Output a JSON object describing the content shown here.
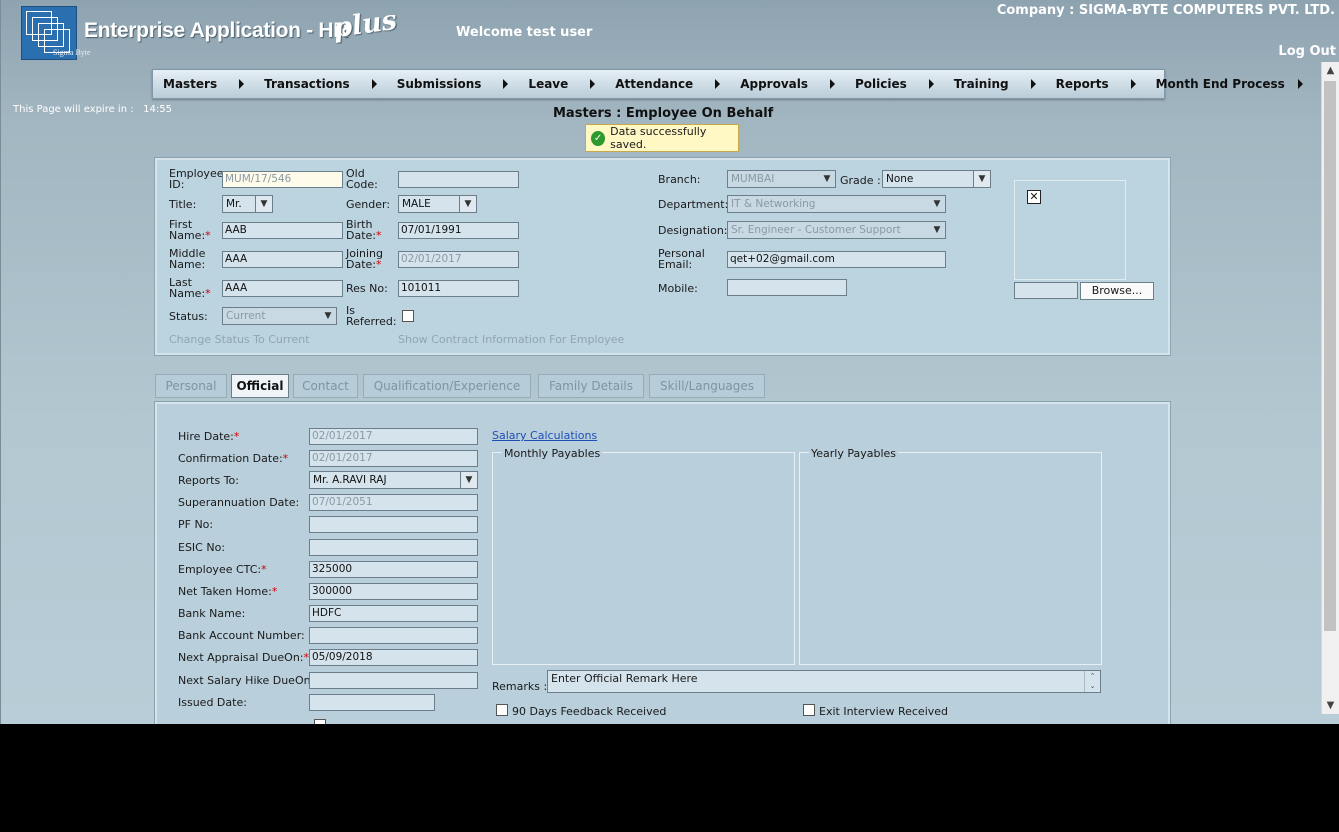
{
  "header": {
    "logo_small": "Sigma Byte",
    "app_title": "Enterprise Application - HR",
    "app_plus": "plus",
    "welcome": "Welcome test user",
    "company": "Company : SIGMA-BYTE COMPUTERS PVT. LTD.",
    "logout": "Log Out"
  },
  "nav": {
    "items": [
      {
        "label": "Masters"
      },
      {
        "label": "Transactions"
      },
      {
        "label": "Submissions"
      },
      {
        "label": "Leave"
      },
      {
        "label": "Attendance"
      },
      {
        "label": "Approvals"
      },
      {
        "label": "Policies"
      },
      {
        "label": "Training"
      },
      {
        "label": "Reports"
      },
      {
        "label": "Month End Process"
      }
    ]
  },
  "expire": "This Page will expire in :   14:55",
  "page_title": "Masters : Employee On Behalf",
  "saved_message": "Data successfully saved.",
  "employee": {
    "employee_id_label": "Employee ID:",
    "employee_id": "MUM/17/546",
    "old_code_label": "Old Code:",
    "old_code": "",
    "title_label": "Title:",
    "title": "Mr.",
    "gender_label": "Gender:",
    "gender": "MALE",
    "first_name_label": "First Name:",
    "first_name": "AAB",
    "birth_date_label": "Birth Date:",
    "birth_date": "07/01/1991",
    "middle_name_label": "Middle Name:",
    "middle_name": "AAA",
    "joining_date_label": "Joining Date:",
    "joining_date": "02/01/2017",
    "last_name_label": "Last Name:",
    "last_name": "AAA",
    "res_no_label": "Res No:",
    "res_no": "101011",
    "status_label": "Status:",
    "status": "Current",
    "is_referred_label": "Is Referred:",
    "change_status_link": "Change Status To Current",
    "contract_link": "Show Contract Information For Employee",
    "branch_label": "Branch:",
    "branch": "MUMBAI",
    "grade_label": "Grade :",
    "grade": "None",
    "department_label": "Department:",
    "department": "IT & Networking",
    "designation_label": "Designation:",
    "designation": "Sr. Engineer - Customer Support",
    "personal_email_label": "Personal Email:",
    "personal_email": "qet+02@gmail.com",
    "mobile_label": "Mobile:",
    "mobile": "",
    "browse": "Browse..."
  },
  "tabs": [
    {
      "label": "Personal",
      "active": false
    },
    {
      "label": "Official",
      "active": true
    },
    {
      "label": "Contact",
      "active": false
    },
    {
      "label": "Qualification/Experience",
      "active": false
    },
    {
      "label": "Family Details",
      "active": false
    },
    {
      "label": "Skill/Languages",
      "active": false
    }
  ],
  "official": {
    "fields": [
      {
        "label": "Hire Date:",
        "required": true,
        "value": "02/01/2017",
        "disabled": true
      },
      {
        "label": "Confirmation Date:",
        "required": true,
        "value": "02/01/2017",
        "disabled": true
      },
      {
        "label": "Reports To:",
        "required": false,
        "value": "Mr. A.RAVI RAJ",
        "select": true
      },
      {
        "label": "Superannuation Date:",
        "required": false,
        "value": "07/01/2051",
        "disabled": true
      },
      {
        "label": "PF No:",
        "required": false,
        "value": ""
      },
      {
        "label": "ESIC No:",
        "required": false,
        "value": ""
      },
      {
        "label": "Employee CTC:",
        "required": true,
        "value": "325000"
      },
      {
        "label": "Net Taken Home:",
        "required": true,
        "value": "300000"
      },
      {
        "label": "Bank Name:",
        "required": false,
        "value": "HDFC"
      },
      {
        "label": "Bank Account Number:",
        "required": false,
        "value": ""
      },
      {
        "label": "Next Appraisal DueOn:",
        "required": true,
        "value": "05/09/2018"
      },
      {
        "label": "Next Salary Hike DueOn:",
        "required": false,
        "value": ""
      },
      {
        "label": "Issued Date:",
        "required": false,
        "value": ""
      }
    ],
    "salary_link": "Salary Calculations",
    "monthly_payables": "Monthly Payables",
    "yearly_payables": "Yearly Payables",
    "remarks_label": "Remarks :",
    "remarks_value": "Enter Official Remark Here",
    "feedback_label": "90 Days Feedback Received",
    "exit_label": "Exit Interview Received"
  }
}
